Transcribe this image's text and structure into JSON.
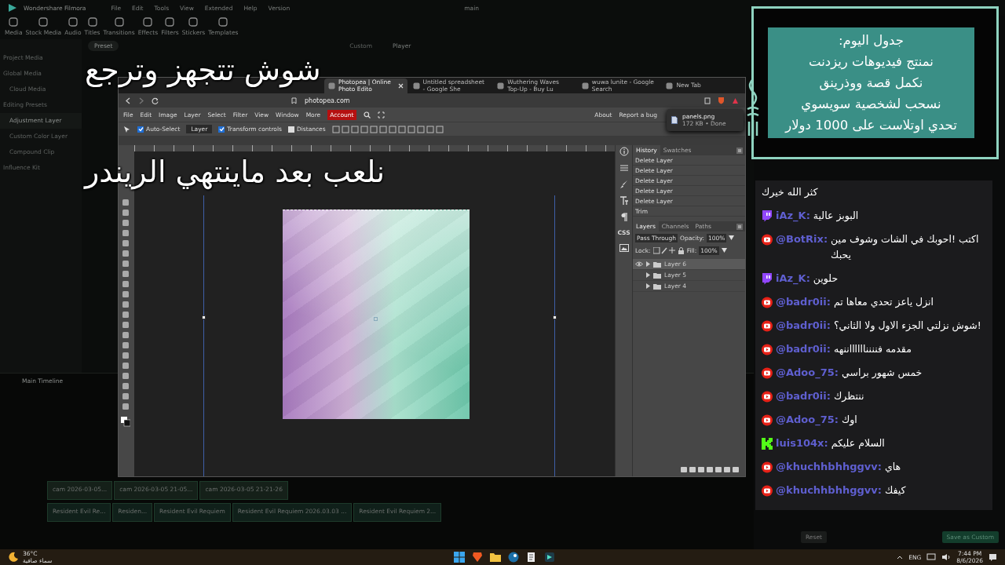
{
  "filmora": {
    "app_title": "Wondershare Filmora",
    "menu": [
      "File",
      "Edit",
      "Tools",
      "View",
      "Extended",
      "Help",
      "Version"
    ],
    "project_name": "main",
    "toolbar": [
      "Media",
      "Stock Media",
      "Audio",
      "Titles",
      "Transitions",
      "Effects",
      "Filters",
      "Stickers",
      "Templates"
    ],
    "sidebar": [
      {
        "label": "Project Media",
        "kind": "group",
        "selected": false
      },
      {
        "label": "Global Media",
        "kind": "group",
        "selected": false
      },
      {
        "label": "Cloud Media",
        "kind": "item",
        "selected": false
      },
      {
        "label": "Editing Presets",
        "kind": "group",
        "selected": false
      },
      {
        "label": "Adjustment Layer",
        "kind": "item",
        "selected": true
      },
      {
        "label": "Custom Color Layer",
        "kind": "item",
        "selected": false
      },
      {
        "label": "Compound Clip",
        "kind": "item",
        "selected": false
      },
      {
        "label": "Influence Kit",
        "kind": "group",
        "selected": false
      }
    ],
    "preset_tabs": [
      {
        "label": "Preset",
        "selected": true
      },
      {
        "label": "Custom",
        "selected": false
      }
    ],
    "player_label": "Player",
    "timeline_label": "Main Timeline",
    "video_clips": [
      "cam 2026-03-05...",
      "cam 2026-03-05 21-05...",
      "cam 2026-03-05 21-21-26"
    ],
    "audio_clips": [
      "Resident Evil Re...",
      "Residen...",
      "Resident Evil Requiem",
      "Resident Evil Requiem 2026.03.03 ...",
      "Resident Evil Requiem 2..."
    ],
    "footer_buttons": [
      "Reset",
      "Save as Custom"
    ]
  },
  "browser": {
    "tabs": [
      {
        "label": "Photopea | Online Photo Edito",
        "selected": true
      },
      {
        "label": "Untitled spreadsheet - Google She",
        "selected": false
      },
      {
        "label": "Wuthering Waves Top-Up - Buy Lu",
        "selected": false
      },
      {
        "label": "wuwa lunite - Google Search",
        "selected": false
      },
      {
        "label": "New Tab",
        "selected": false
      }
    ],
    "url": "photopea.com",
    "download": {
      "file": "panels.png",
      "detail": "172 KB • Done"
    }
  },
  "photopea": {
    "menu": [
      {
        "label": "File",
        "highlighted": false
      },
      {
        "label": "Edit",
        "highlighted": false
      },
      {
        "label": "Image",
        "highlighted": false
      },
      {
        "label": "Layer",
        "highlighted": false
      },
      {
        "label": "Select",
        "highlighted": false
      },
      {
        "label": "Filter",
        "highlighted": false
      },
      {
        "label": "View",
        "highlighted": false
      },
      {
        "label": "Window",
        "highlighted": false
      },
      {
        "label": "More",
        "highlighted": false
      },
      {
        "label": "Account",
        "highlighted": true
      }
    ],
    "links": [
      "About",
      "Report a bug"
    ],
    "options": [
      {
        "label": "Auto-Select",
        "checked": true
      },
      {
        "label": "Transform controls",
        "checked": true
      },
      {
        "label": "Distances",
        "checked": false
      }
    ],
    "target": "Layer",
    "side_label": "CSS",
    "history_tabs": [
      {
        "label": "History",
        "selected": true
      },
      {
        "label": "Swatches",
        "selected": false
      }
    ],
    "history": [
      "Delete Layer",
      "Delete Layer",
      "Delete Layer",
      "Delete Layer",
      "Delete Layer",
      "Trim"
    ],
    "layers_tabs": [
      {
        "label": "Layers",
        "selected": true
      },
      {
        "label": "Channels",
        "selected": false
      },
      {
        "label": "Paths",
        "selected": false
      }
    ],
    "blend": "Pass Through",
    "opacity_label": "Opacity:",
    "opacity": "100%",
    "lock_label": "Lock:",
    "fill_label": "Fill:",
    "fill": "100%",
    "layers": [
      {
        "name": "Layer 6",
        "selected": true,
        "visible": true
      },
      {
        "name": "Layer 5",
        "selected": false,
        "visible": false
      },
      {
        "name": "Layer 4",
        "selected": false,
        "visible": false
      }
    ]
  },
  "caption": [
    "شوش تتجهز وترجع",
    "نلعب بعد ماينتهي الريندر"
  ],
  "schedule": [
    "جدول اليوم:",
    "نمنتج فيديوهات ريزدنت",
    "نكمل قصة ووذرينق",
    "نسحب لشخصية سويسوي",
    "تحدي اوتلاست على 1000 دولار"
  ],
  "chat": [
    {
      "kind": "plain",
      "text": "كثر الله خيرك"
    },
    {
      "kind": "twitch",
      "user": "iAz_K:",
      "text": "البوبز عالية"
    },
    {
      "kind": "youtube",
      "user": "@BotRix:",
      "text": "اكتب !احوبك في الشات وشوف مين يحبك"
    },
    {
      "kind": "twitch",
      "user": "iAz_K:",
      "text": "حلوين"
    },
    {
      "kind": "youtube",
      "user": "@badr0ii:",
      "text": "انزل ياعز تحدي معاها تم"
    },
    {
      "kind": "youtube",
      "user": "@badr0ii:",
      "text": "شوش نزلتي الجزء الاول ولا الثاني؟!"
    },
    {
      "kind": "youtube",
      "user": "@badr0ii:",
      "text": "مقدمه فننننااااااننهه"
    },
    {
      "kind": "youtube",
      "user": "@Adoo_75:",
      "text": "خمس شهور براسي"
    },
    {
      "kind": "youtube",
      "user": "@badr0ii:",
      "text": "ننتظرك"
    },
    {
      "kind": "youtube",
      "user": "@Adoo_75:",
      "text": "اوك"
    },
    {
      "kind": "kick",
      "user": "luis104x:",
      "text": "السلام عليكم"
    },
    {
      "kind": "youtube",
      "user": "@khuchhbhhggvv:",
      "text": "هاي"
    },
    {
      "kind": "youtube",
      "user": "@khuchhbhhggvv:",
      "text": "كيفك"
    }
  ],
  "taskbar": {
    "temperature": "36°C",
    "condition": "سماء صافية",
    "language": "ENG",
    "time": "7:44 PM",
    "date": "8/6/2026"
  }
}
